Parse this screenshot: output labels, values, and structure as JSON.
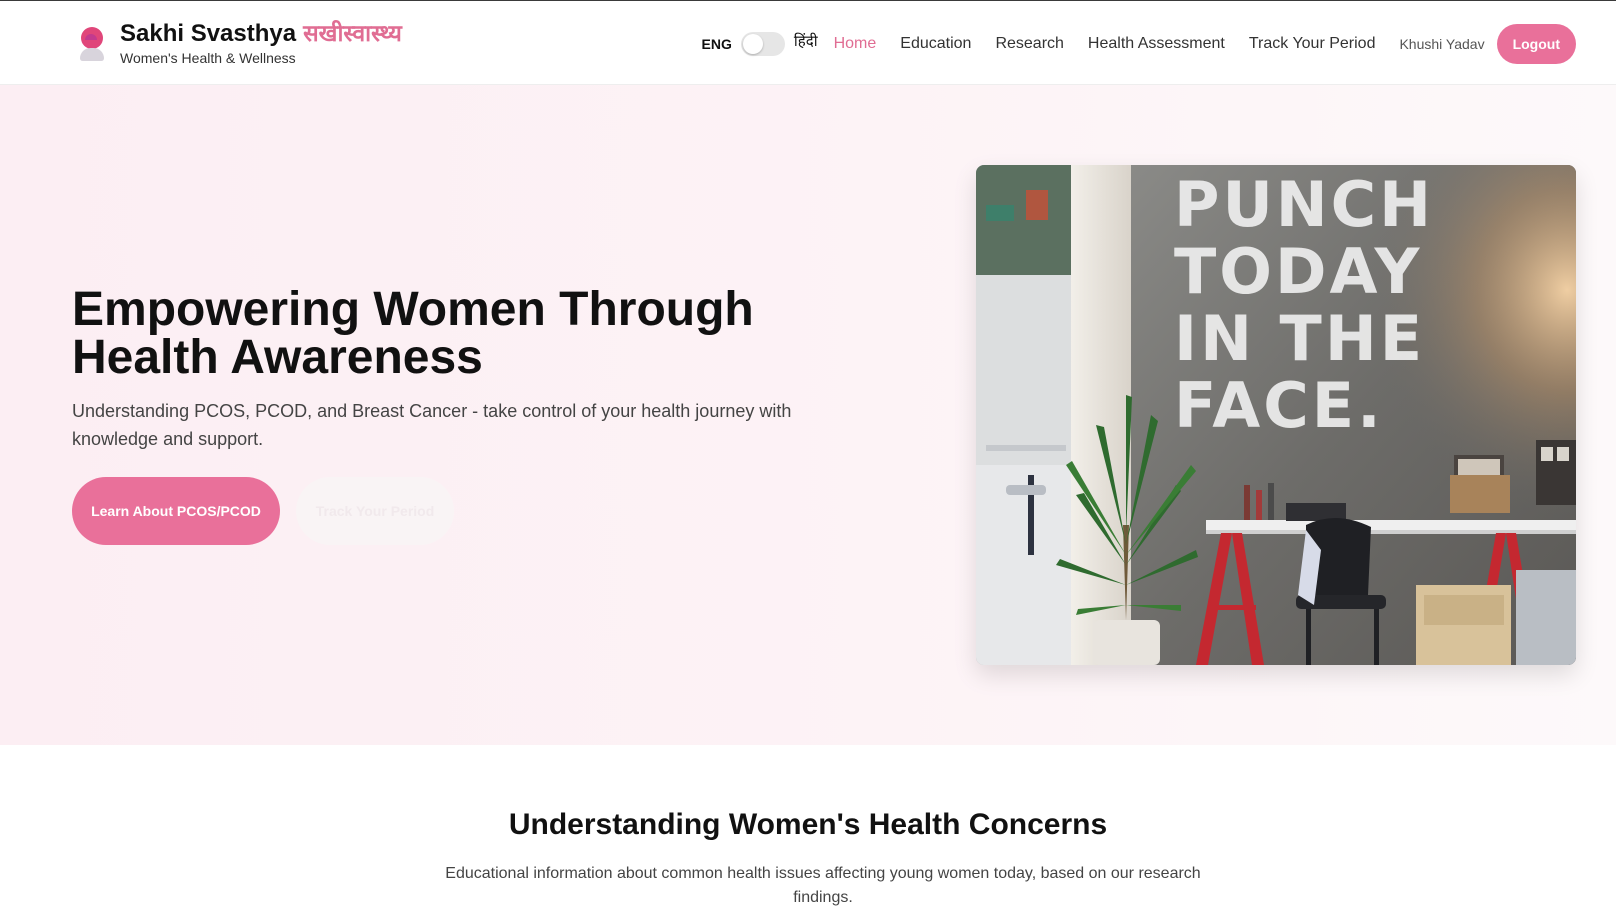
{
  "brand": {
    "name": "Sakhi Svasthya",
    "name_hindi": "सखीस्वास्थ्य",
    "tagline": "Women's Health & Wellness"
  },
  "language_toggle": {
    "left_label": "ENG",
    "right_label": "हिंदी",
    "state": "off"
  },
  "nav": {
    "items": [
      {
        "label": "Home",
        "active": true
      },
      {
        "label": "Education",
        "active": false
      },
      {
        "label": "Research",
        "active": false
      },
      {
        "label": "Health Assessment",
        "active": false
      },
      {
        "label": "Track Your Period",
        "active": false
      }
    ],
    "user_name": "Khushi Yadav",
    "logout_label": "Logout"
  },
  "hero": {
    "title": "Empowering Women Through Health Awareness",
    "description": "Understanding PCOS, PCOD, and Breast Cancer - take control of your health journey with knowledge and support.",
    "primary_button": "Learn About PCOS/PCOD",
    "secondary_button": "Track Your Period",
    "image_wall_text": "PUNCH\nTODAY\nIN THE\nFACE."
  },
  "concerns_section": {
    "title": "Understanding Women's Health Concerns",
    "description": "Educational information about common health issues affecting young women today, based on our research findings."
  },
  "colors": {
    "accent": "#e9709a",
    "accent_text": "#e06d93",
    "hero_background": "#fceef3"
  }
}
